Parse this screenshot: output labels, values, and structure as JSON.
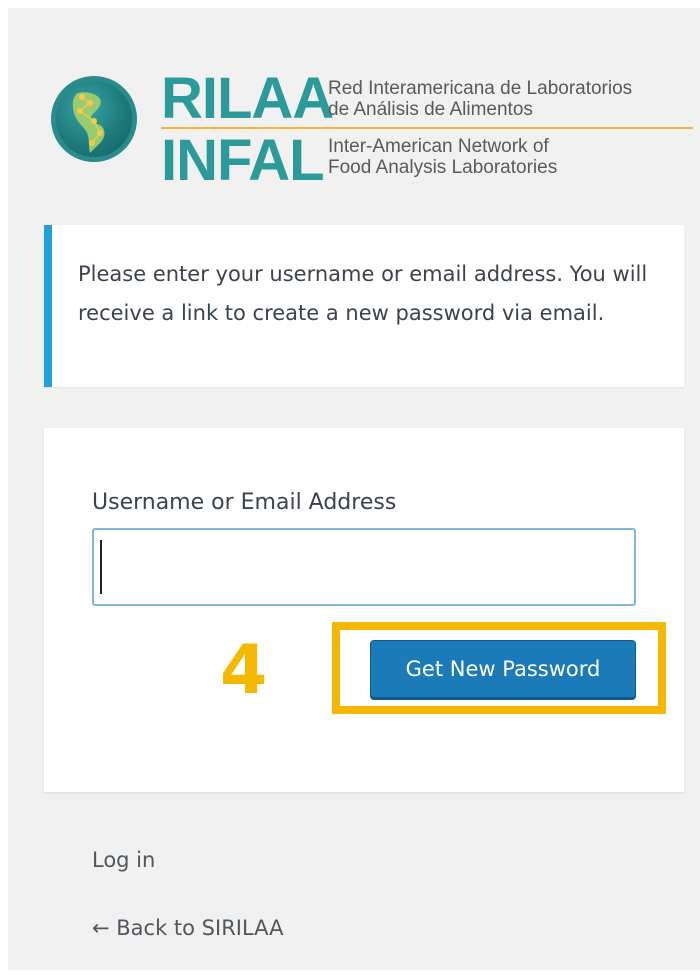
{
  "logo": {
    "acronym_top": "RILAA",
    "acronym_bottom": "INFAL",
    "name_es_line1": "Red Interamericana de Laboratorios",
    "name_es_line2": "de Análisis de Alimentos",
    "name_en_line1": "Inter-American Network of",
    "name_en_line2": "Food Analysis Laboratories",
    "icon": "globe-americas-icon"
  },
  "message": {
    "text": "Please enter your username or email address. You will receive a link to create a new password via email."
  },
  "form": {
    "username_label": "Username or Email Address",
    "username_value": "",
    "submit_label": "Get New Password"
  },
  "annotation": {
    "step_number": "4"
  },
  "links": {
    "login": "Log in",
    "back": "← Back to SIRILAA"
  },
  "colors": {
    "accent": "#1fa0d8",
    "button": "#1b7bb8",
    "highlight": "#f5b800",
    "brand": "#2d9a9a",
    "brand_line": "#f0b73a"
  }
}
